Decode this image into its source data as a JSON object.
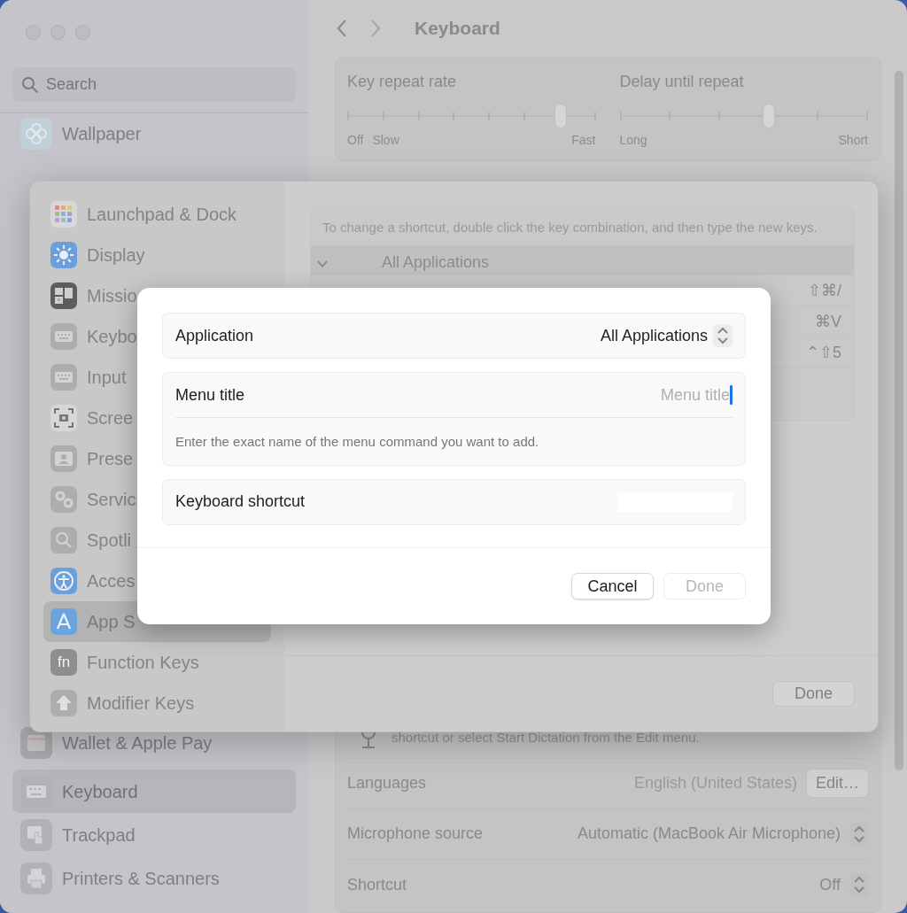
{
  "window": {
    "title": "Keyboard"
  },
  "sidebar": {
    "search": {
      "placeholder": "Search"
    },
    "items": [
      {
        "label": "Wallpaper",
        "selected": false
      },
      {
        "label": "Wallet & Apple Pay",
        "selected": false
      },
      {
        "label": "Keyboard",
        "selected": true
      },
      {
        "label": "Trackpad",
        "selected": false
      },
      {
        "label": "Printers & Scanners",
        "selected": false
      }
    ]
  },
  "sliders": [
    {
      "label": "Key repeat rate",
      "level": 0.86,
      "tick_labels": [
        "Off",
        "Slow",
        "Fast"
      ]
    },
    {
      "label": "Delay until repeat",
      "level": 0.6,
      "tick_labels": [
        "Long",
        "Short"
      ]
    }
  ],
  "dictation": {
    "text": "shortcut or select Start Dictation from the Edit menu."
  },
  "settings": [
    {
      "kind": "button",
      "label": "Languages",
      "value": "English (United States)",
      "button": "Edit…"
    },
    {
      "kind": "popup",
      "label": "Microphone source",
      "value": "Automatic (MacBook Air Microphone)"
    },
    {
      "kind": "popup",
      "label": "Shortcut",
      "value": "Off"
    }
  ],
  "sheet": {
    "sidebar": [
      {
        "label": "Launchpad & Dock",
        "selected": false
      },
      {
        "label": "Display",
        "selected": false
      },
      {
        "label": "Missio",
        "selected": false
      },
      {
        "label": "Keybo",
        "selected": false
      },
      {
        "label": "Input",
        "selected": false
      },
      {
        "label": "Scree",
        "selected": false
      },
      {
        "label": "Prese",
        "selected": false
      },
      {
        "label": "Servic",
        "selected": false
      },
      {
        "label": "Spotli",
        "selected": false
      },
      {
        "label": "Acces",
        "selected": false
      },
      {
        "label": "App S",
        "selected": true
      },
      {
        "label": "Function Keys",
        "selected": false,
        "glyph": "fn"
      },
      {
        "label": "Modifier Keys",
        "selected": false
      }
    ],
    "description": "To change a shortcut, double click the key combination, and then type the new keys.",
    "group": {
      "label": "All Applications",
      "expanded": true
    },
    "shortcuts": [
      "⇧⌘/",
      "⌘V",
      "⌃⇧5"
    ],
    "done_button": "Done"
  },
  "dialog": {
    "fields": [
      {
        "kind": "popup",
        "label": "Application",
        "value": "All Applications"
      },
      {
        "kind": "text",
        "label": "Menu title",
        "placeholder": "Menu title",
        "focused": true,
        "help": "Enter the exact name of the menu command you want to add."
      },
      {
        "kind": "shortcut",
        "label": "Keyboard shortcut"
      }
    ],
    "buttons": [
      {
        "label": "Cancel",
        "disabled": false
      },
      {
        "label": "Done",
        "disabled": true
      }
    ]
  }
}
